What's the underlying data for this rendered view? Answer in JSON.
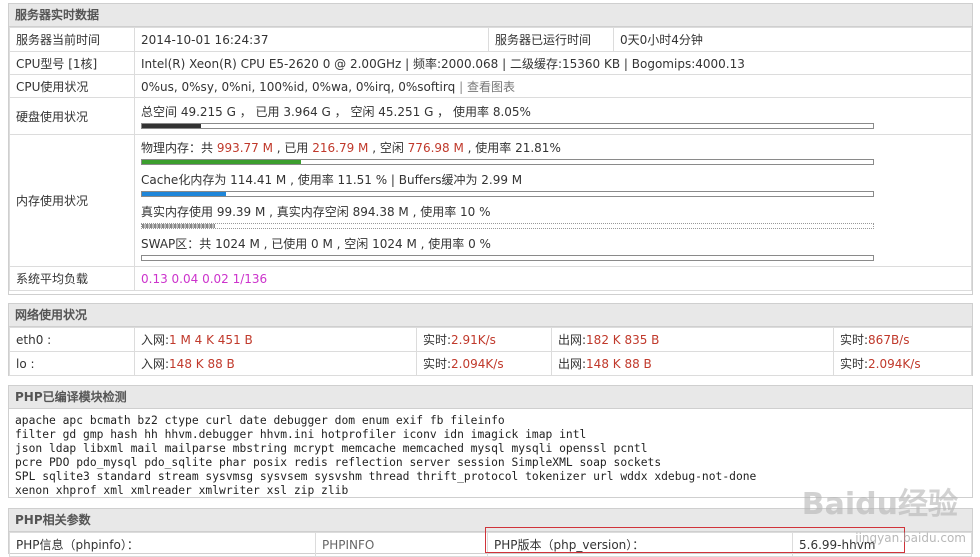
{
  "server": {
    "title": "服务器实时数据",
    "time_label": "服务器当前时间",
    "time_value": "2014-10-01 16:24:37",
    "uptime_label": "服务器已运行时间",
    "uptime_value": "0天0小时4分钟",
    "cpu_model_label": "CPU型号 [1核]",
    "cpu_model_value": "Intel(R) Xeon(R) CPU E5-2620 0 @ 2.00GHz | 频率:2000.068 | 二级缓存:15360 KB | Bogomips:4000.13",
    "cpu_usage_label": "CPU使用状况",
    "cpu_usage_value": "0%us, 0%sy, 0%ni, 100%id, 0%wa, 0%irq, 0%softirq",
    "cpu_usage_link": "查看图表",
    "disk_label": "硬盘使用状况",
    "disk_value": "总空间 49.215 G ， 已用 3.964 G ， 空闲 45.251 G ， 使用率 8.05%",
    "disk_usage_fraction": 0.0805,
    "mem_label": "内存使用状况",
    "mem": {
      "phys_prefix": "物理内存：共 ",
      "phys_total": "993.77 M",
      "phys_used_prefix": " , 已用 ",
      "phys_used": "216.79 M",
      "phys_free_prefix": " , 空闲 ",
      "phys_free": "776.98 M",
      "phys_rate": " , 使用率 21.81%",
      "phys_fraction": 0.2181,
      "cache_text": "Cache化内存为 114.41 M , 使用率 11.51 % | Buffers缓冲为 2.99 M",
      "cache_fraction": 0.1151,
      "real_text": "真实内存使用 99.39 M , 真实内存空闲 894.38 M , 使用率 10 %",
      "real_fraction": 0.1,
      "swap_text": "SWAP区：共 1024 M , 已使用 0 M , 空闲 1024 M , 使用率 0 %",
      "swap_fraction": 0
    },
    "load_label": "系统平均负载",
    "load_value": "0.13 0.04 0.02 1/136"
  },
  "network": {
    "title": "网络使用状况",
    "in_label": "入网:",
    "out_label": "出网:",
    "rt_label": "实时:",
    "rows": [
      {
        "iface": "eth0 :",
        "in": "1 M 4 K 451 B",
        "in_rt": "2.91K/s",
        "out": "182 K 835 B",
        "out_rt": "867B/s"
      },
      {
        "iface": "lo :",
        "in": "148 K 88 B",
        "in_rt": "2.094K/s",
        "out": "148 K 88 B",
        "out_rt": "2.094K/s"
      }
    ]
  },
  "php_modules": {
    "title": "PHP已编译模块检测",
    "lines": [
      "apache  apc  bcmath  bz2  ctype  curl  date  debugger  dom  enum  exif  fb  fileinfo",
      "filter  gd  gmp  hash  hh  hhvm.debugger  hhvm.ini  hotprofiler  iconv  idn  imagick  imap  intl",
      "json  ldap  libxml  mail  mailparse  mbstring  mcrypt  memcache  memcached  mysql  mysqli  openssl  pcntl",
      "pcre  PDO  pdo_mysql  pdo_sqlite  phar  posix  redis  reflection  server  session  SimpleXML  soap  sockets",
      "SPL  sqlite3  standard  stream  sysvmsg  sysvsem  sysvshm  thread  thrift_protocol  tokenizer  url  wddx  xdebug-not-done",
      "xenon  xhprof  xml  xmlreader  xmlwriter  xsl  zip  zlib"
    ]
  },
  "php_params": {
    "title": "PHP相关参数",
    "phpinfo_label": "PHP信息（phpinfo）：",
    "phpinfo_value": "PHPINFO",
    "version_label": "PHP版本（php_version）：",
    "version_value": "5.6.99-hhvm"
  },
  "watermark": {
    "brand": "Baidu经验",
    "url": "jingyan.baidu.com"
  }
}
